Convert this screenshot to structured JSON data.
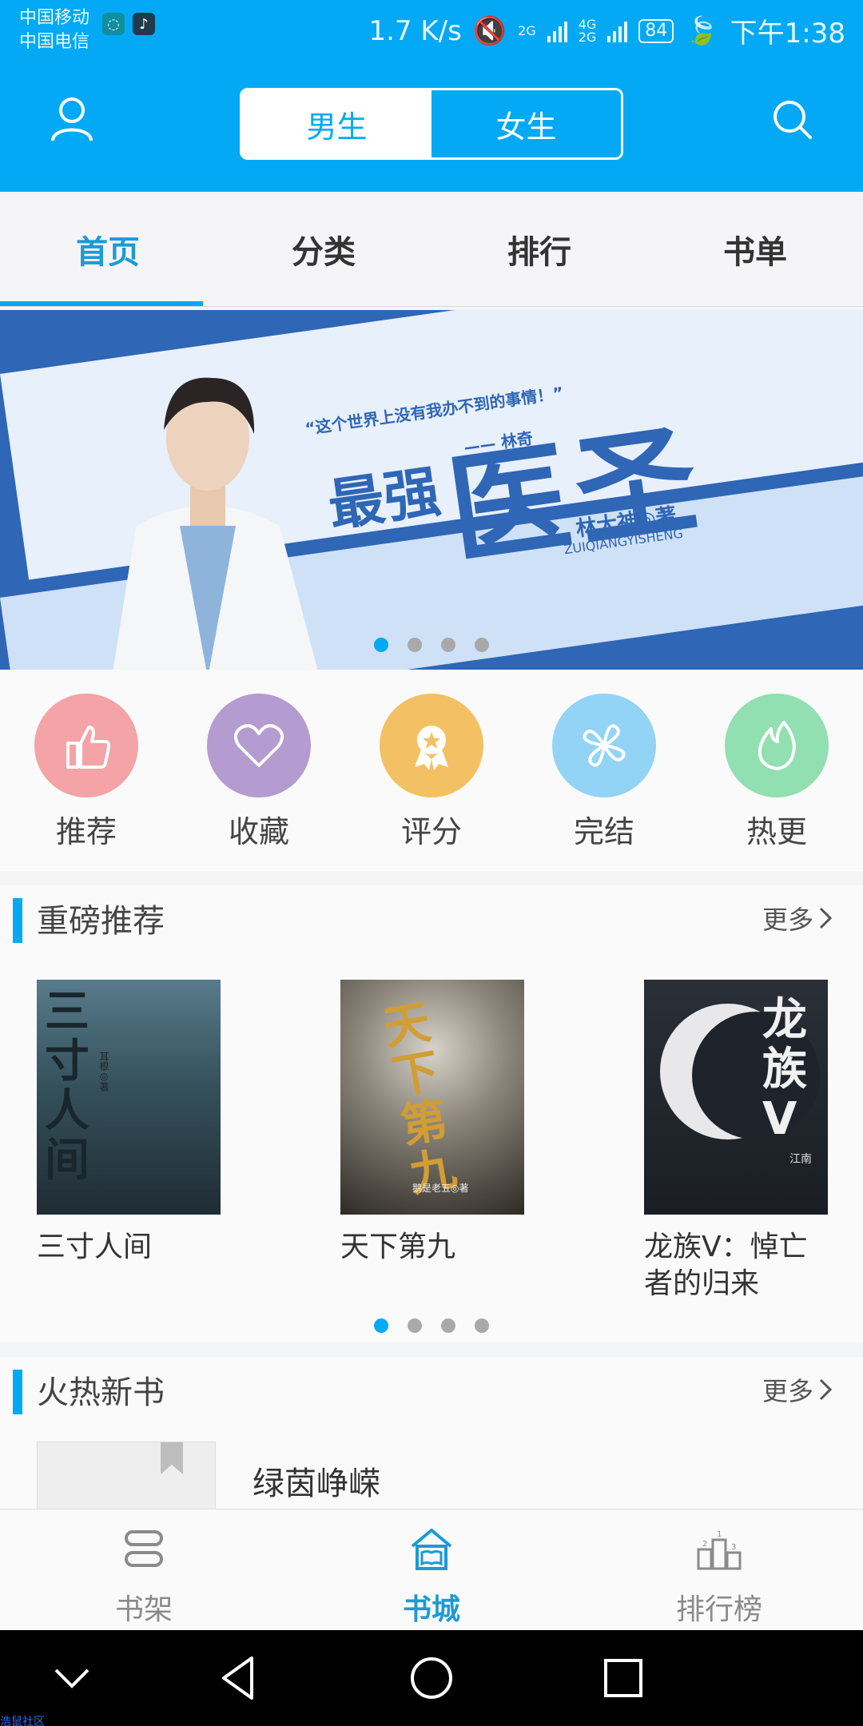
{
  "status": {
    "carrier1": "中国移动",
    "carrier2": "中国电信",
    "speed": "1.7 K/s",
    "net1": "2G",
    "net2": "4G",
    "net3": "2G",
    "battery": "84",
    "time": "下午1:38"
  },
  "header": {
    "gender_male": "男生",
    "gender_female": "女生",
    "active_gender": "男生"
  },
  "tabs": [
    {
      "label": "首页",
      "active": true
    },
    {
      "label": "分类",
      "active": false
    },
    {
      "label": "排行",
      "active": false
    },
    {
      "label": "书单",
      "active": false
    }
  ],
  "banner": {
    "quote_line1": "“这个世界上没有我办不到的事情！”",
    "quote_line2": "—— 林奇",
    "title_small": "最强",
    "title_big": "医圣",
    "author": "林大神◎著",
    "pinyin": "ZUIQIANGYISHENG",
    "dot_count": 4,
    "active_dot": 0
  },
  "quick_links": [
    {
      "label": "推荐",
      "icon": "thumbs-up-icon",
      "color": "#f4a3a6"
    },
    {
      "label": "收藏",
      "icon": "heart-icon",
      "color": "#b49bd0"
    },
    {
      "label": "评分",
      "icon": "award-icon",
      "color": "#f3c164"
    },
    {
      "label": "完结",
      "icon": "clover-icon",
      "color": "#93d3f6"
    },
    {
      "label": "热更",
      "icon": "flame-icon",
      "color": "#92dfb1"
    }
  ],
  "featured": {
    "title": "重磅推荐",
    "more": "更多",
    "books": [
      {
        "title": "三寸人间",
        "cover_text": "三寸人间",
        "cover_author": "耳根◎著"
      },
      {
        "title": "天下第九",
        "cover_text": "天下第九",
        "cover_author": "鹅是老五◎著"
      },
      {
        "title": "龙族V：悼亡者的归来",
        "cover_text": "龙族V",
        "cover_author": "江南"
      }
    ],
    "dot_count": 4,
    "active_dot": 0
  },
  "new_books": {
    "title": "火热新书",
    "more": "更多",
    "first_book": "绿茵峥嵘"
  },
  "bottom_nav": [
    {
      "label": "书架",
      "icon": "bookshelf-icon",
      "active": false
    },
    {
      "label": "书城",
      "icon": "bookstore-icon",
      "active": true
    },
    {
      "label": "排行榜",
      "icon": "ranking-podium-icon",
      "active": false
    }
  ],
  "watermark": "浩鼠社区",
  "colors": {
    "accent": "#03a9f4",
    "accent_text": "#1c9ad6"
  }
}
